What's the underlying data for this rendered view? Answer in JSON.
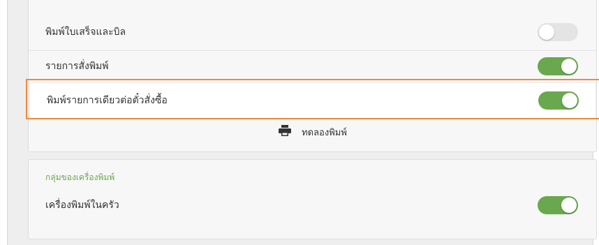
{
  "settings_card": {
    "rows": [
      {
        "label": "พิมพ์ใบเสร็จและบิล",
        "enabled": false
      },
      {
        "label": "รายการสั่งพิมพ์",
        "enabled": true
      },
      {
        "label": "พิมพ์รายการเดียวต่อตั๋วสั่งซื้อ",
        "enabled": true
      }
    ],
    "test_print_label": "ทดลองพิมพ์",
    "test_print_icon": "printer-icon"
  },
  "printer_group": {
    "title": "กลุ่มของเครื่องพิมพ์",
    "rows": [
      {
        "label": "เครื่องพิมพ์ในครัว",
        "enabled": true
      }
    ]
  },
  "colors": {
    "toggle_on": "#6aa84f",
    "toggle_off": "#e4e4e4",
    "highlight": "#f08a3a",
    "section_title": "#6aa84f"
  }
}
